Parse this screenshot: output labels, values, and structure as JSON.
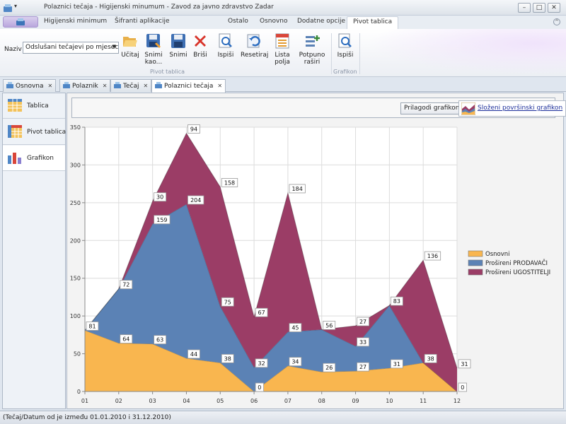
{
  "window": {
    "title": "Polaznici tečaja - Higijenski minumum - Zavod za javno zdravstvo Zadar",
    "quick_access": "▾",
    "minimize": "–",
    "maximize": "□",
    "close": "✕"
  },
  "ribbon_tabs": {
    "left": [
      "Higijenski minimum",
      "Šifranti aplikacije"
    ],
    "right": [
      "Ostalo",
      "Osnovno",
      "Dodatne opcije",
      "Pivot tablica"
    ],
    "active": "Pivot tablica"
  },
  "ribbon": {
    "naziv_label": "Naziv",
    "naziv_value": "Odslušani tečajevi po mjesecima",
    "buttons": [
      {
        "label": "Učitaj",
        "icon": "folder-open-icon"
      },
      {
        "label": "Snimi kao...",
        "icon": "save-as-icon"
      },
      {
        "label": "Snimi",
        "icon": "save-icon"
      },
      {
        "label": "Briši",
        "icon": "delete-icon"
      },
      {
        "label": "Ispiši",
        "icon": "print-preview-icon"
      },
      {
        "label": "Resetiraj",
        "icon": "reset-icon"
      },
      {
        "label": "Lista polja",
        "icon": "field-list-icon"
      },
      {
        "label": "Potpuno raširi",
        "icon": "expand-all-icon"
      },
      {
        "label": "Ispiši",
        "icon": "print-preview-icon"
      }
    ],
    "group1_label": "Pivot tablica",
    "group2_label": "Grafikon"
  },
  "doc_tabs": [
    "Osnovna",
    "Polaznik",
    "Tečaj",
    "Polaznici tečaja"
  ],
  "doc_tab_close": "✕",
  "leftnav": [
    "Tablica",
    "Pivot tablica",
    "Grafikon"
  ],
  "toolbar": {
    "customize_button": "Prilagodi grafikon",
    "chart_type_link": "Složeni površinski grafikon"
  },
  "chart_data": {
    "type": "area",
    "stacked": true,
    "categories": [
      "01",
      "02",
      "03",
      "04",
      "05",
      "06",
      "07",
      "08",
      "09",
      "10",
      "11",
      "12"
    ],
    "ylim": [
      0,
      350
    ],
    "yticks": [
      0,
      50,
      100,
      150,
      200,
      250,
      300,
      350
    ],
    "grid": true,
    "legend_position": "right",
    "series": [
      {
        "name": "Osnovni",
        "color": "#F9B64F",
        "values": [
          81,
          64,
          63,
          44,
          38,
          0,
          34,
          26,
          27,
          31,
          38,
          0
        ]
      },
      {
        "name": "Prošireni PRODAVAČI",
        "color": "#5B82B5",
        "values": [
          0,
          72,
          159,
          204,
          75,
          32,
          45,
          56,
          33,
          83,
          0,
          0
        ]
      },
      {
        "name": "Prošireni UGOSTITELJI",
        "color": "#9B3D66",
        "values": [
          0,
          0,
          30,
          94,
          158,
          67,
          184,
          0,
          27,
          0,
          136,
          31
        ]
      }
    ],
    "data_labels": [
      {
        "x": "01",
        "text": "81"
      },
      {
        "x": "02",
        "text": "64"
      },
      {
        "x": "02",
        "text": "72"
      },
      {
        "x": "03",
        "text": "63"
      },
      {
        "x": "03",
        "text": "159"
      },
      {
        "x": "03",
        "text": "30"
      },
      {
        "x": "04",
        "text": "44"
      },
      {
        "x": "04",
        "text": "204"
      },
      {
        "x": "04",
        "text": "94"
      },
      {
        "x": "05",
        "text": "38"
      },
      {
        "x": "05",
        "text": "75"
      },
      {
        "x": "05",
        "text": "158"
      },
      {
        "x": "06",
        "text": "0"
      },
      {
        "x": "06",
        "text": "32"
      },
      {
        "x": "06",
        "text": "67"
      },
      {
        "x": "07",
        "text": "34"
      },
      {
        "x": "07",
        "text": "45"
      },
      {
        "x": "07",
        "text": "184"
      },
      {
        "x": "08",
        "text": "26"
      },
      {
        "x": "08",
        "text": "56"
      },
      {
        "x": "09",
        "text": "27"
      },
      {
        "x": "09",
        "text": "33"
      },
      {
        "x": "09",
        "text": "27"
      },
      {
        "x": "10",
        "text": "31"
      },
      {
        "x": "10",
        "text": "83"
      },
      {
        "x": "11",
        "text": "38"
      },
      {
        "x": "11",
        "text": "136"
      },
      {
        "x": "12",
        "text": "0"
      },
      {
        "x": "12",
        "text": "31"
      }
    ]
  },
  "status": "(Tečaj/Datum od je između 01.01.2010 i 31.12.2010)"
}
